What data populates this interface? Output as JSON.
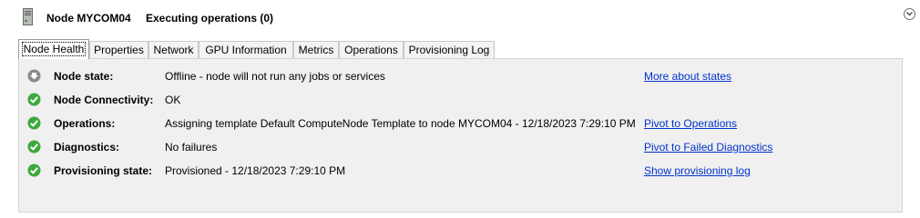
{
  "header": {
    "node_title": "Node MYCOM04",
    "operations_title": "Executing operations (0)",
    "server_icon": "server-tower-icon",
    "collapse_icon": "chevron-down-circle-icon"
  },
  "tabs": [
    {
      "label": "Node Health",
      "active": true
    },
    {
      "label": "Properties",
      "active": false
    },
    {
      "label": "Network",
      "active": false
    },
    {
      "label": "GPU Information",
      "active": false
    },
    {
      "label": "Metrics",
      "active": false
    },
    {
      "label": "Operations",
      "active": false
    },
    {
      "label": "Provisioning Log",
      "active": false
    }
  ],
  "rows": [
    {
      "label": "Node state:",
      "value": "Offline - node will not run any jobs or services",
      "link": "More about states",
      "status": "offline",
      "icon": "down-arrow-gray-icon"
    },
    {
      "label": "Node Connectivity:",
      "value": "OK",
      "link": "",
      "status": "ok",
      "icon": "green-check-icon"
    },
    {
      "label": "Operations:",
      "value": "Assigning template Default ComputeNode Template to node MYCOM04 - 12/18/2023 7:29:10 PM",
      "link": "Pivot to Operations",
      "status": "ok",
      "icon": "green-check-icon"
    },
    {
      "label": "Diagnostics:",
      "value": "No failures",
      "link": "Pivot to Failed Diagnostics",
      "status": "ok",
      "icon": "green-check-icon"
    },
    {
      "label": "Provisioning state:",
      "value": "Provisioned - 12/18/2023 7:29:10 PM",
      "link": "Show provisioning log",
      "status": "ok",
      "icon": "green-check-icon"
    }
  ],
  "colors": {
    "link": "#0033cc",
    "ok_green": "#3ea83e",
    "offline_gray": "#8a8a8a",
    "panel_bg": "#f0f0f0"
  }
}
